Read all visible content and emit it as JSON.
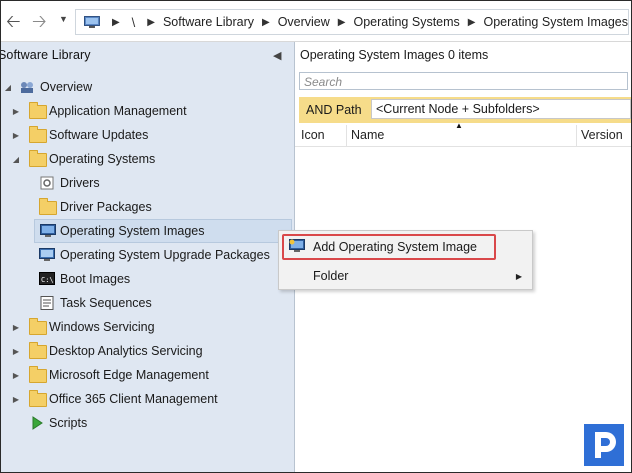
{
  "address_bar": {
    "root": "\\",
    "crumbs": [
      "Software Library",
      "Overview",
      "Operating Systems",
      "Operating System Images"
    ]
  },
  "nav": {
    "title": "Software Library",
    "items": [
      {
        "label": "Overview",
        "icon": "overview-icon"
      },
      {
        "label": "Application Management",
        "icon": "folder-icon"
      },
      {
        "label": "Software Updates",
        "icon": "folder-icon"
      },
      {
        "label": "Operating Systems",
        "icon": "folder-icon"
      },
      {
        "label": "Drivers",
        "icon": "drivers-icon"
      },
      {
        "label": "Driver Packages",
        "icon": "folder-icon"
      },
      {
        "label": "Operating System Images",
        "icon": "os-image-icon"
      },
      {
        "label": "Operating System Upgrade Packages",
        "icon": "os-upgrade-icon"
      },
      {
        "label": "Boot Images",
        "icon": "boot-image-icon"
      },
      {
        "label": "Task Sequences",
        "icon": "task-sequence-icon"
      },
      {
        "label": "Windows Servicing",
        "icon": "folder-icon"
      },
      {
        "label": "Desktop Analytics Servicing",
        "icon": "folder-icon"
      },
      {
        "label": "Microsoft Edge Management",
        "icon": "folder-icon"
      },
      {
        "label": "Office 365 Client Management",
        "icon": "folder-icon"
      },
      {
        "label": "Scripts",
        "icon": "scripts-icon"
      }
    ]
  },
  "list": {
    "title": "Operating System Images 0 items",
    "search_placeholder": "Search",
    "filter_label": "AND Path",
    "filter_value": "<Current Node + Subfolders>",
    "columns": [
      "Icon",
      "Name",
      "Version"
    ]
  },
  "context_menu": {
    "items": [
      {
        "label": "Add Operating System Image",
        "highlighted": true
      },
      {
        "label": "Folder",
        "submenu": true
      }
    ]
  },
  "colors": {
    "nav_bg": "#dfe7f2",
    "filter_bg": "#f6dc8a",
    "highlight_border": "#d9484a",
    "logo": "#2f6fd6"
  }
}
